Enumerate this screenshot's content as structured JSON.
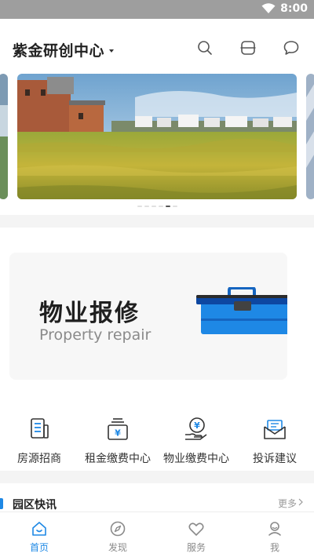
{
  "status_bar": {
    "time": "8:00"
  },
  "header": {
    "title": "紫金研创中心",
    "icons": [
      "search-icon",
      "scan-icon",
      "message-icon"
    ]
  },
  "banner": {
    "slide_count": 6,
    "active_index": 4
  },
  "repair_card": {
    "title": "物业报修",
    "subtitle": "Property repair"
  },
  "quick_actions": [
    {
      "label": "房源招商",
      "icon": "document-icon"
    },
    {
      "label": "租金缴费中心",
      "icon": "rent-payment-icon"
    },
    {
      "label": "物业缴费中心",
      "icon": "property-payment-icon"
    },
    {
      "label": "投诉建议",
      "icon": "envelope-icon"
    }
  ],
  "news": {
    "title": "园区快讯",
    "more": "更多"
  },
  "tabbar": {
    "items": [
      {
        "label": "首页",
        "icon": "home-icon",
        "active": true
      },
      {
        "label": "发现",
        "icon": "compass-icon",
        "active": false
      },
      {
        "label": "服务",
        "icon": "heart-icon",
        "active": false
      },
      {
        "label": "我",
        "icon": "user-icon",
        "active": false
      }
    ]
  },
  "colors": {
    "accent": "#1e88e5",
    "status_bar": "#9e9e9e"
  }
}
